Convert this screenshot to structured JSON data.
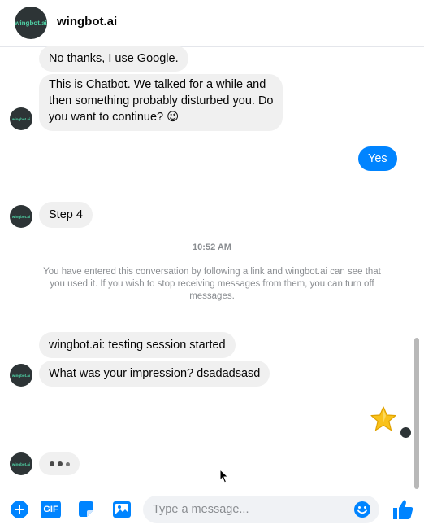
{
  "header": {
    "avatar_text": "wingbot.ai",
    "title": "wingbot.ai"
  },
  "avatar_text": "wingbot.ai",
  "messages": {
    "m1": "No thanks, I use Google.",
    "m2_line1": "This is Chatbot. We talked for a while and",
    "m2_line2": "then something probably disturbed you. Do",
    "m2_line3": "you want to continue? 😉",
    "yes": "Yes",
    "step4": "Step 4",
    "time": "10:52 AM",
    "notice_line1": "You have entered this conversation by following a link and wingbot.ai can see that",
    "notice_line2": "you used it. If you wish to stop receiving messages from them, you can turn off",
    "notice_line3": "messages.",
    "session": "wingbot.ai: testing session started",
    "impression": "What was your impression? dsadadsasd"
  },
  "composer": {
    "gif_label": "GIF",
    "placeholder": "Type a message...",
    "icons": [
      "plus-icon",
      "gif-icon",
      "sticker-icon",
      "photo-icon",
      "emoji-icon",
      "thumbs-up-icon"
    ]
  },
  "colors": {
    "accent": "#0084ff",
    "bubble_incoming": "#f0f0f0",
    "avatar_bg": "#2d3436",
    "avatar_text": "#4fd1a5"
  }
}
